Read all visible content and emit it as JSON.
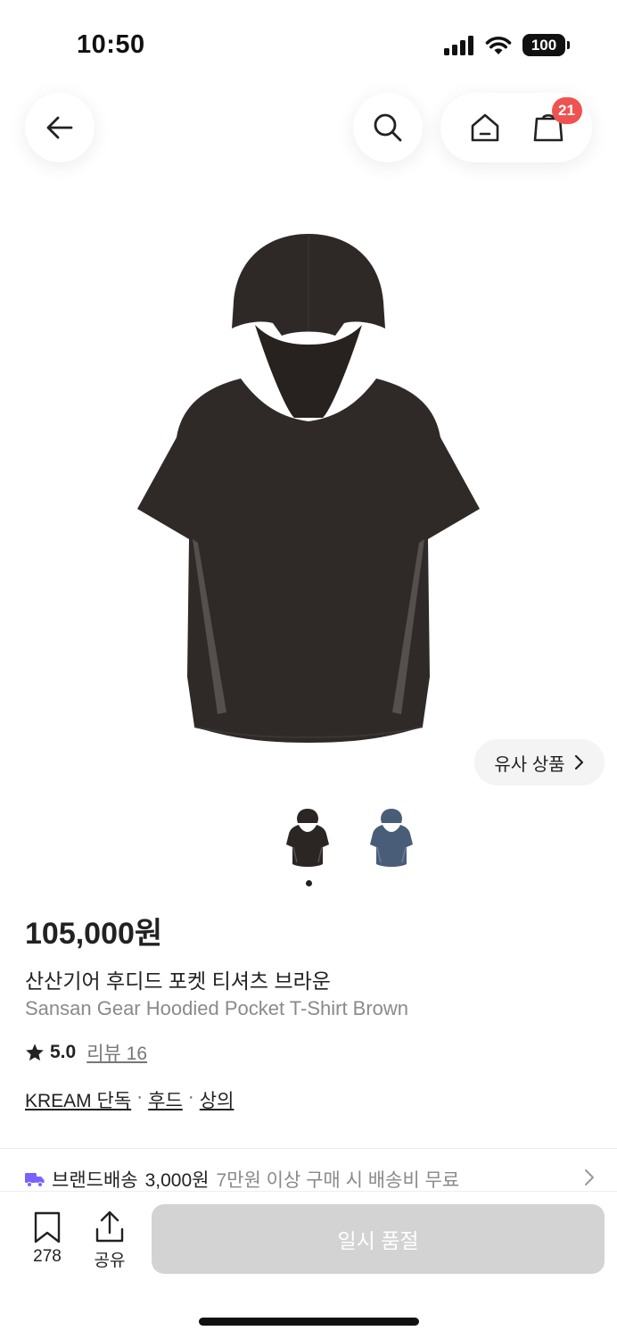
{
  "status_bar": {
    "time": "10:50",
    "battery": "100"
  },
  "header": {
    "cart_count": "21"
  },
  "product": {
    "similar_label": "유사 상품",
    "thumbnail_colors": [
      "#2b2624",
      "#4a5d78"
    ],
    "price": "105,000원",
    "name_ko": "산산기어 후디드 포켓 티셔츠 브라운",
    "name_en": "Sansan Gear Hoodied Pocket T-Shirt Brown",
    "rating": "5.0",
    "review_label": "리뷰 16",
    "tags": [
      "KREAM 단독",
      "후드",
      "상의"
    ],
    "tag_separator": "·"
  },
  "delivery": {
    "label": "브랜드배송",
    "fee": "3,000원",
    "note": "7만원 이상 구매 시 배송비 무료",
    "accent_color": "#7b61ff"
  },
  "bottom_bar": {
    "bookmark_count": "278",
    "share_label": "공유",
    "action_label": "일시 품절"
  }
}
